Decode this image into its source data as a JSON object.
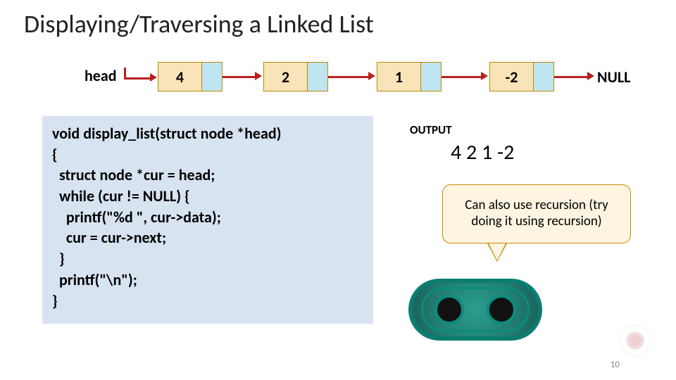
{
  "title": "Displaying/Traversing a Linked List",
  "head_label": "head",
  "nodes": [
    "4",
    "2",
    "1",
    "-2"
  ],
  "null_label": "NULL",
  "code": "void display_list(struct node *head)\n{\n  struct node *cur = head;\n  while (cur != NULL) {\n    printf(\"%d \", cur->data);\n    cur = cur->next;\n  }\n  printf(\"\\n\");\n}",
  "output_label": "OUTPUT",
  "output_value": "4 2 1 -2",
  "callout": "Can also use recursion (try doing it using recursion)",
  "page_number": "10"
}
